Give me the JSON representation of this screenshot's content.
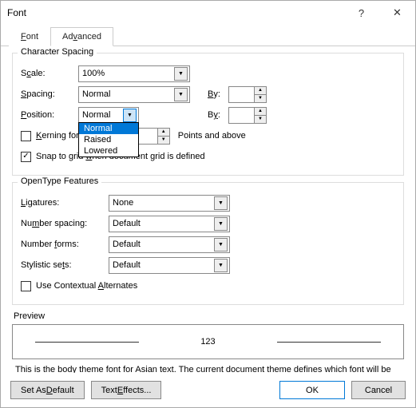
{
  "titlebar": {
    "title": "Font",
    "help_glyph": "?",
    "close_glyph": "✕"
  },
  "tabs": {
    "font": "Font",
    "advanced": "Advanced"
  },
  "charSpacing": {
    "legend": "Character Spacing",
    "scale_lbl": "Scale:",
    "scale_value": "100%",
    "spacing_lbl": "Spacing:",
    "spacing_value": "Normal",
    "position_lbl": "Position:",
    "position_value": "Normal",
    "by_lbl": "By:",
    "kerning_lbl": "Kerning for fonts:",
    "points_and_above": "Points and above",
    "snap_lbl": "Snap to grid when document grid is defined"
  },
  "positionOptions": [
    "Normal",
    "Raised",
    "Lowered"
  ],
  "openType": {
    "legend": "OpenType Features",
    "ligatures_lbl": "Ligatures:",
    "ligatures_value": "None",
    "numspacing_lbl": "Number spacing:",
    "numspacing_value": "Default",
    "numforms_lbl": "Number forms:",
    "numforms_value": "Default",
    "stylistic_lbl": "Stylistic sets:",
    "stylistic_value": "Default",
    "contextual_lbl": "Use Contextual Alternates"
  },
  "preview": {
    "legend": "Preview",
    "sample": "123",
    "note": "This is the body theme font for Asian text. The current document theme defines which font will be used."
  },
  "footer": {
    "set_default": "Set As Default",
    "text_effects": "Text Effects...",
    "ok": "OK",
    "cancel": "Cancel"
  }
}
